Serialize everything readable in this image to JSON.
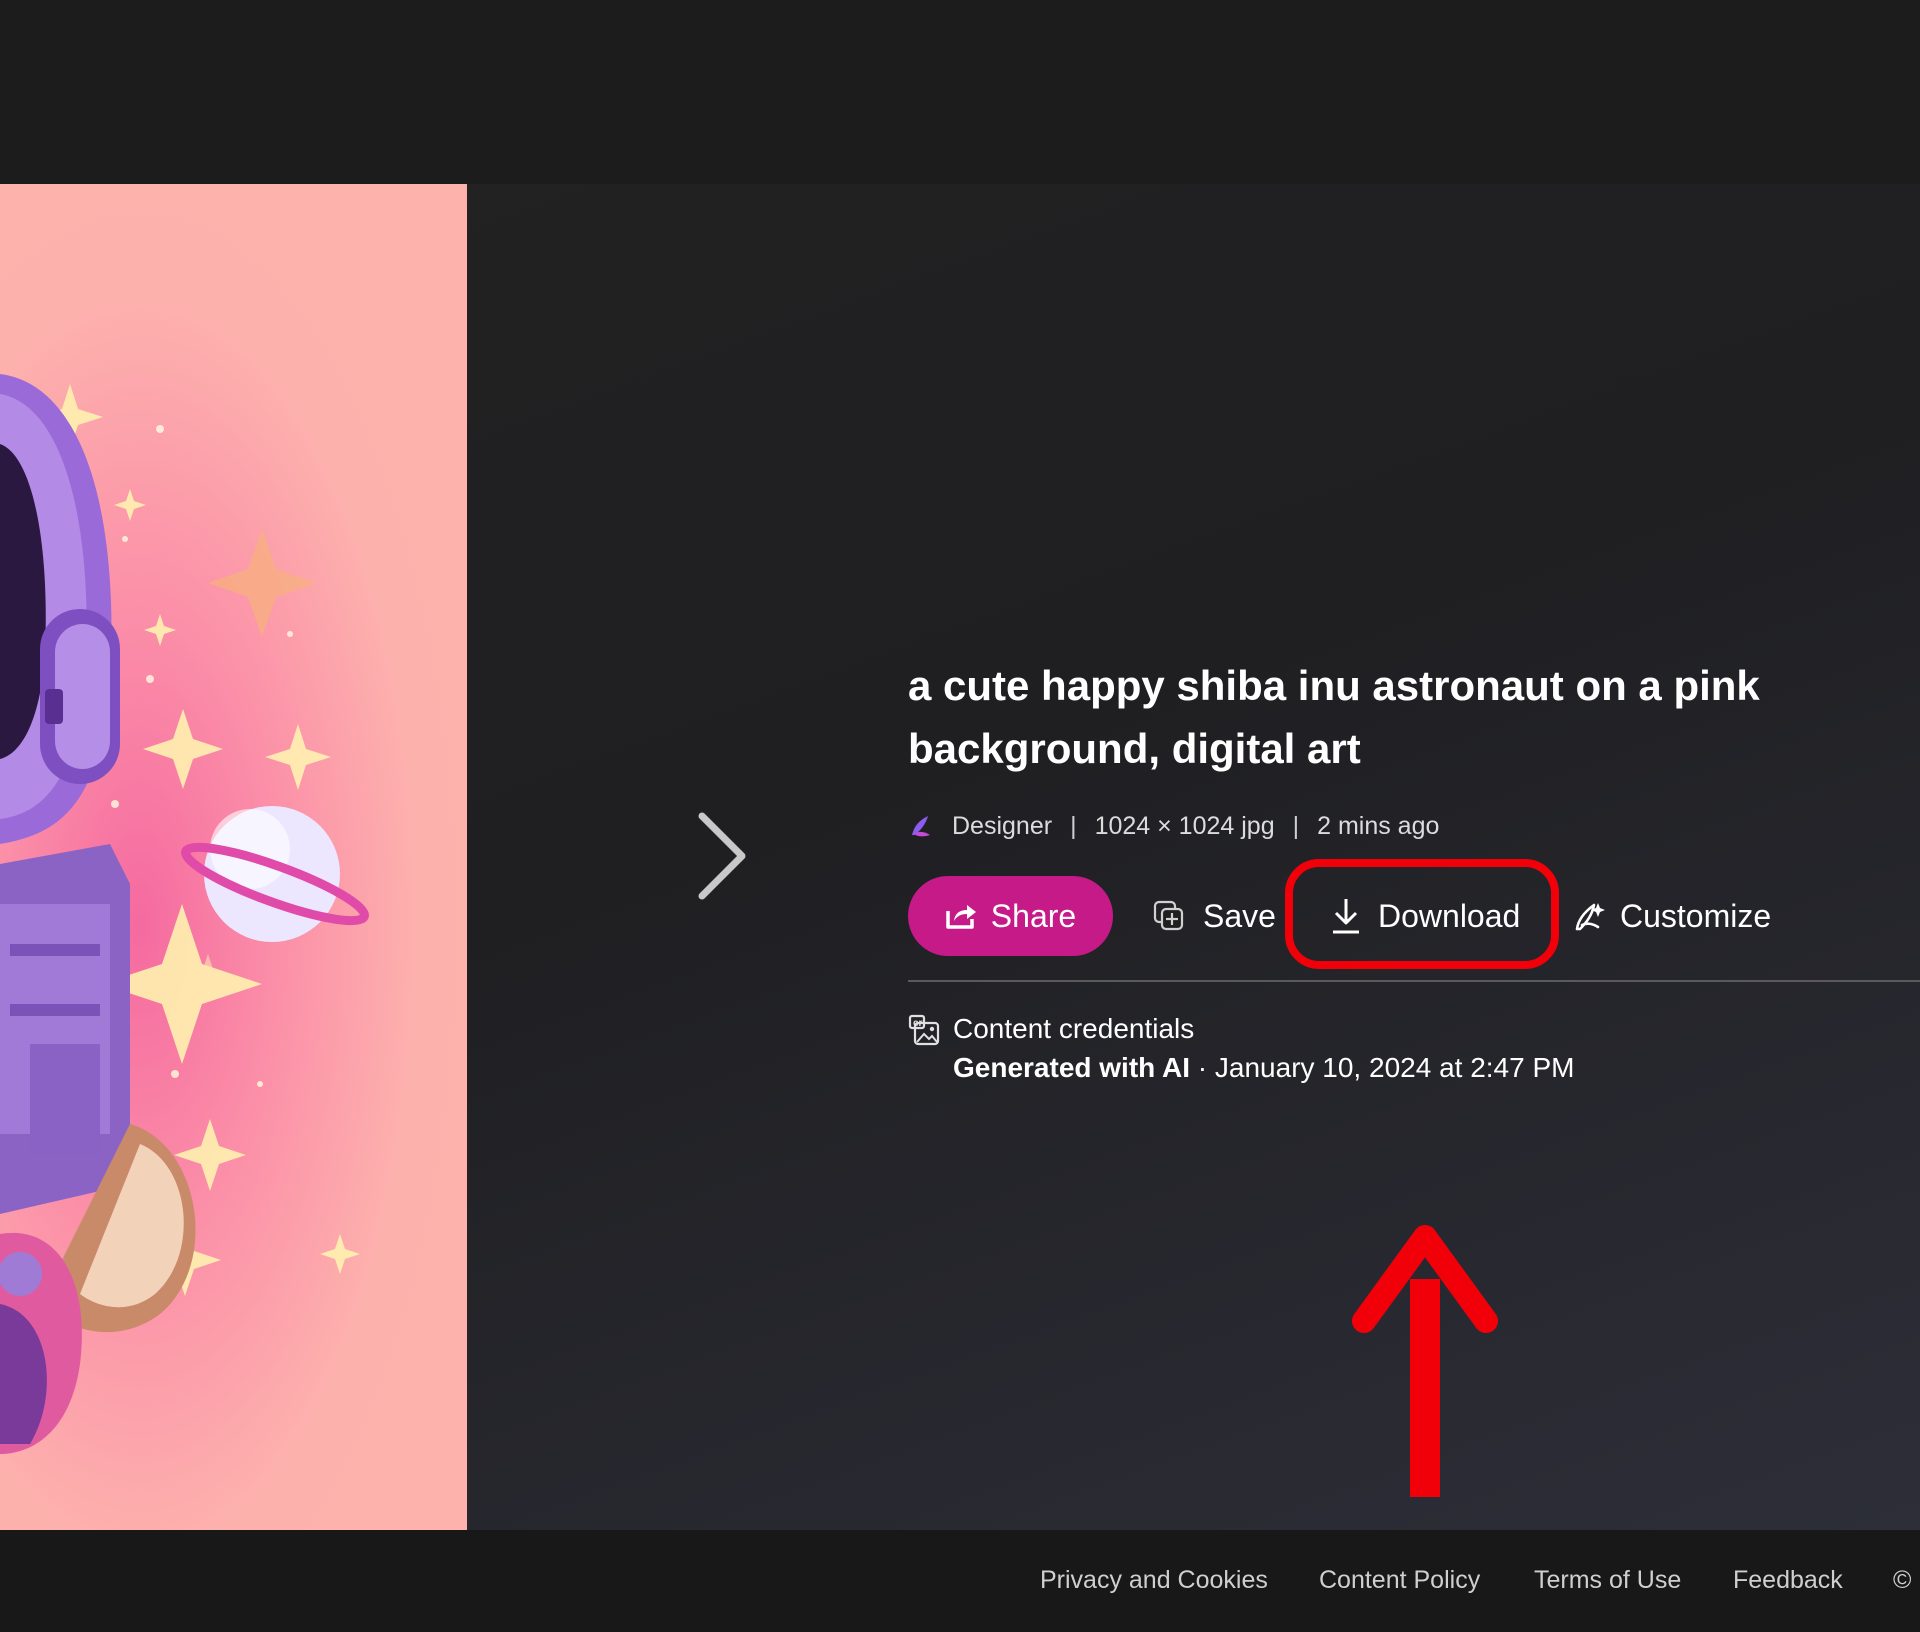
{
  "image": {
    "title": "a cute happy shiba inu astronaut on a pink background, digital art"
  },
  "meta": {
    "designer_label": "Designer",
    "dimensions": "1024 × 1024 jpg",
    "time_ago": "2 mins ago",
    "separator": "|"
  },
  "actions": {
    "share_label": "Share",
    "save_label": "Save",
    "download_label": "Download",
    "customize_label": "Customize"
  },
  "credentials": {
    "heading": "Content credentials",
    "generated_label": "Generated with AI",
    "date_text": " · January 10, 2024 at 2:47 PM"
  },
  "footer": {
    "links": [
      "Privacy and Cookies",
      "Content Policy",
      "Terms of Use",
      "Feedback"
    ],
    "copyright_symbol": "©"
  },
  "colors": {
    "share_button": "#c51a87",
    "annotation_red": "#f2000a",
    "background": "#1c1c1c"
  },
  "icons": {
    "next": "chevron-right-icon",
    "share": "share-icon",
    "save": "collection-add-icon",
    "download": "download-icon",
    "customize": "brush-icon",
    "credentials": "content-credentials-icon"
  }
}
